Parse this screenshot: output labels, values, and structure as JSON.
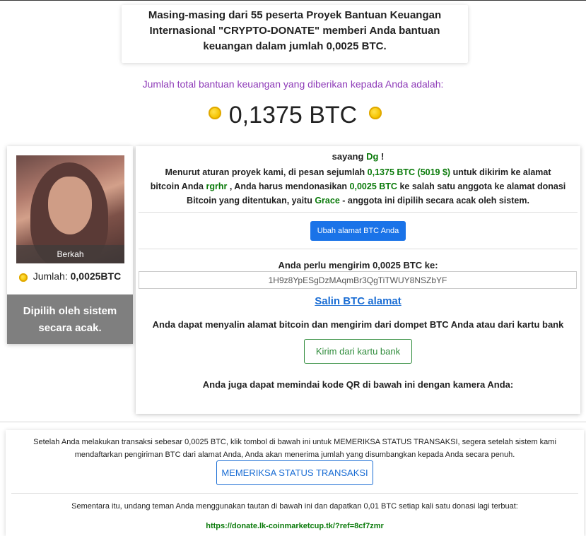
{
  "header": {
    "line1": "Masing-masing dari 55 peserta Proyek Bantuan Keuangan",
    "line2": "Internasional \"CRYPTO-DONATE\" memberi Anda bantuan",
    "line3": "keuangan dalam jumlah 0,0025 BTC."
  },
  "total": {
    "label": "Jumlah total bantuan keuangan yang diberikan kepada Anda adalah:",
    "value": "0,1375 BTC",
    "coin_icon": "bitcoin-coin-icon"
  },
  "profile": {
    "name": "Berkah",
    "amount_label": "Jumlah:",
    "amount_value": "0,0025BTC",
    "picked_line1": "Dipilih oleh sistem",
    "picked_line2": "secara acak."
  },
  "main": {
    "greeting_prefix": "sayang",
    "user_name": "Dg",
    "greeting_suffix": "!",
    "rules_part1": "Menurut aturan proyek kami, di pesan sejumlah",
    "rules_amount": "0,1375 BTC (5019 $)",
    "rules_part2": "untuk dikirim ke alamat",
    "rules_part3": "bitcoin Anda",
    "rules_addr": "rgrhr",
    "rules_part4": ", Anda harus mendonasikan",
    "rules_donate": "0,0025 BTC",
    "rules_part5": "ke salah satu anggota ke alamat donasi",
    "rules_part6": "Bitcoin yang ditentukan, yaitu",
    "rules_member": "Grace",
    "rules_part7": "- anggota ini dipilih secara acak oleh sistem.",
    "change_button": "Ubah alamat BTC Anda",
    "send_label": "Anda perlu mengirim 0,0025 BTC ke:",
    "btc_address": "1H9z8YpESgDzMAqmBr3QgTiTWUY8NSZbYF",
    "copy_link": "Salin BTC alamat",
    "copy_desc": "Anda dapat menyalin alamat bitcoin dan mengirim dari dompet BTC Anda atau dari kartu bank",
    "card_button": "Kirim dari kartu bank",
    "qr_text": "Anda juga dapat memindai kode QR di bawah ini dengan kamera Anda:"
  },
  "bottom": {
    "text_line1": "Setelah Anda melakukan transaksi sebesar 0,0025 BTC, klik tombol di bawah ini untuk MEMERIKSA STATUS TRANSAKSI, segera setelah sistem kami",
    "text_line2": "mendaftarkan pengiriman BTC dari alamat Anda, Anda akan menerima jumlah yang disumbangkan kepada Anda secara penuh.",
    "check_button": "MEMERIKSA STATUS TRANSAKSI",
    "invite_text": "Sementara itu, undang teman Anda menggunakan tautan di bawah ini dan dapatkan 0,01 BTC setiap kali satu donasi lagi terbuat:",
    "ref_link": "https://donate.lk-coinmarketcup.tk/?ref=8cf7zmr"
  },
  "colors": {
    "accent_blue": "#1a73e8",
    "green_text": "#0a7a0a",
    "purple_label": "#8e3bb8",
    "gray_box": "#7f7f7f"
  }
}
